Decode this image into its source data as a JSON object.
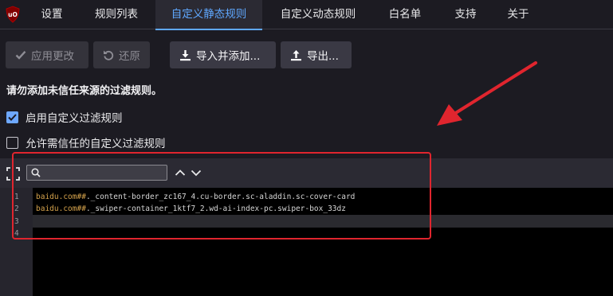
{
  "tabs": [
    {
      "label": "设置"
    },
    {
      "label": "规则列表"
    },
    {
      "label": "自定义静态规则"
    },
    {
      "label": "自定义动态规则"
    },
    {
      "label": "白名单"
    },
    {
      "label": "支持"
    },
    {
      "label": "关于"
    }
  ],
  "active_tab_index": 2,
  "toolbar": {
    "apply_label": "应用更改",
    "revert_label": "还原",
    "import_label": "导入并添加...",
    "export_label": "导出..."
  },
  "warning_text": "请勿添加未信任来源的过滤规则。",
  "options": {
    "enable_custom_filters": {
      "label": "启用自定义过滤规则",
      "checked": true
    },
    "allow_trusted_filters": {
      "label": "允许需信任的自定义过滤规则",
      "checked": false
    }
  },
  "editor": {
    "search_value": "",
    "lines": [
      {
        "number": "1",
        "domain": "baidu.com",
        "separator": "##",
        "selector": "._content-border_zc167_4.cu-border.sc-aladdin.sc-cover-card"
      },
      {
        "number": "2",
        "domain": "baidu.com",
        "separator": "##",
        "selector": "._swiper-container_1ktf7_2.wd-ai-index-pc.swiper-box_33dz"
      },
      {
        "number": "3",
        "domain": "",
        "separator": "",
        "selector": ""
      },
      {
        "number": "4",
        "domain": "",
        "separator": "",
        "selector": ""
      }
    ]
  },
  "colors": {
    "accent": "#5fa8ff",
    "annotation_red": "#e0252e",
    "background": "#1c1b22"
  }
}
